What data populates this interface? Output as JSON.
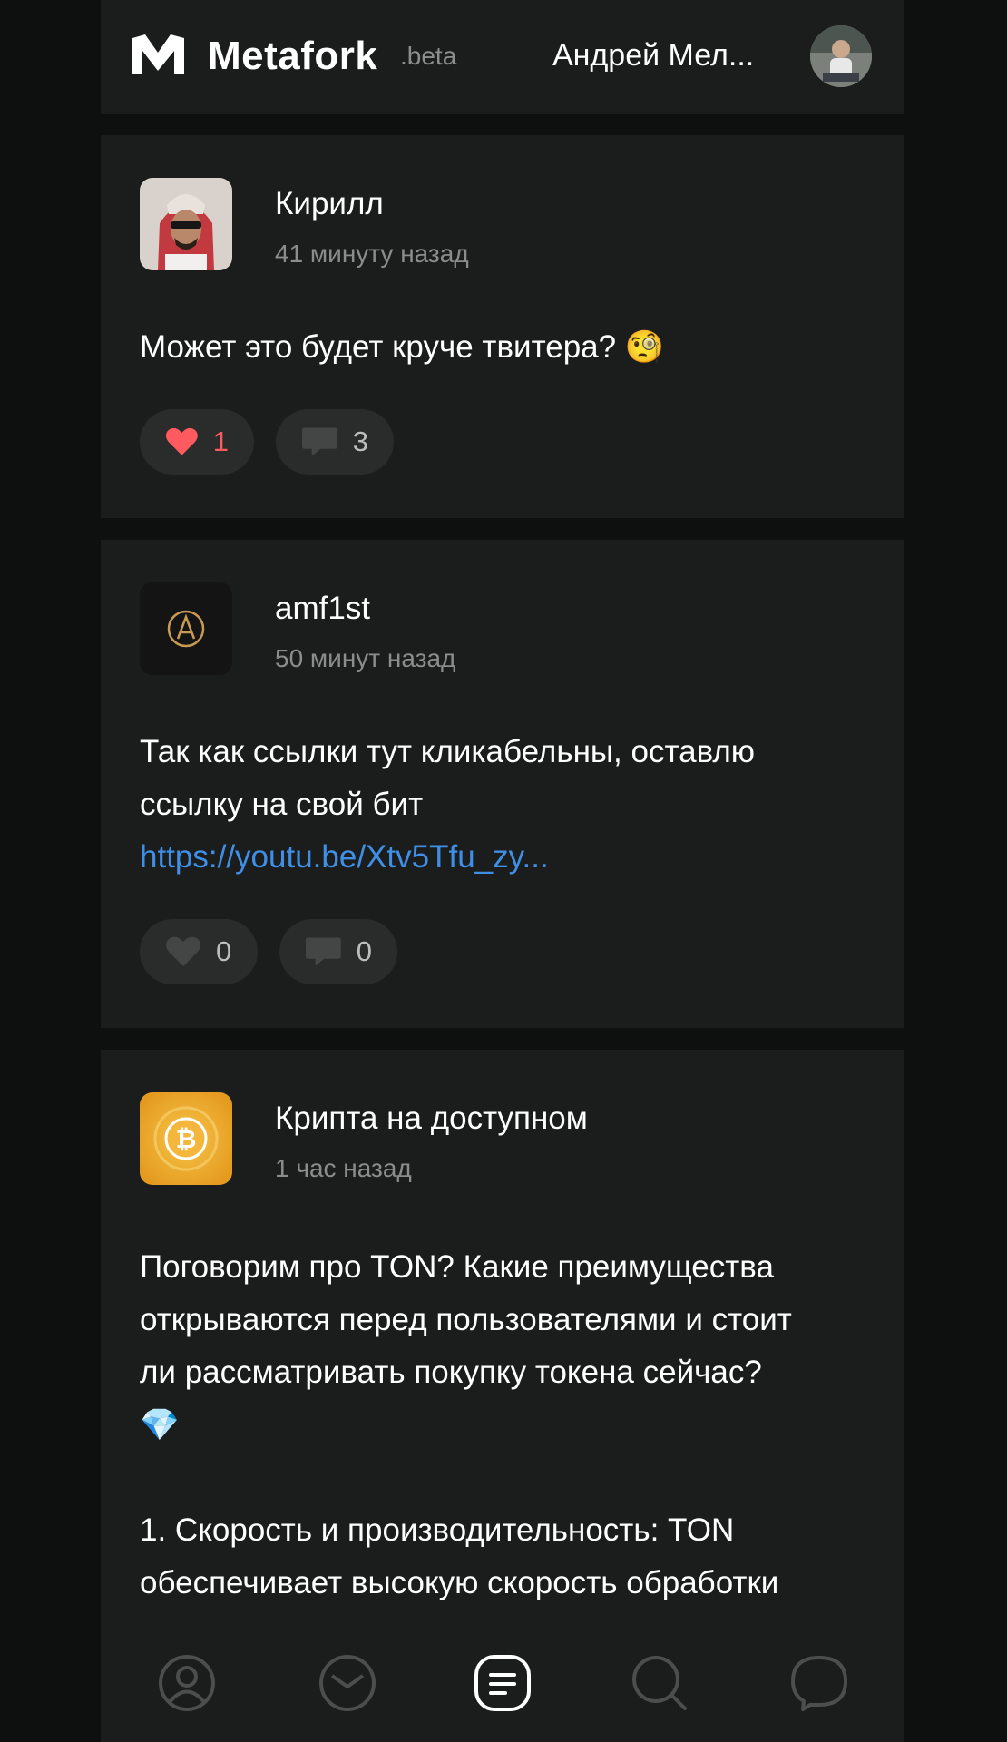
{
  "header": {
    "logo_text": "Metafork",
    "beta_label": ".beta",
    "user_name": "Андрей Мел...",
    "logo_icon": "metafork-m-logo",
    "avatar": "user-avatar-photo"
  },
  "posts": [
    {
      "author": "Кирилл",
      "time": "41 минуту назад",
      "text_lines": [
        "Может это будет круче твитера? 🧐"
      ],
      "link": "",
      "likes": "1",
      "comments": "3",
      "liked": true
    },
    {
      "author": "amf1st",
      "time": "50 минут назад",
      "text_lines": [
        "Так как ссылки тут кликабельны, оставлю",
        "ссылку на свой бит"
      ],
      "link": "https://youtu.be/Xtv5Tfu_zy...",
      "likes": "0",
      "comments": "0",
      "liked": false
    },
    {
      "author": "Крипта на доступном",
      "time": "1 час назад",
      "text_lines": [
        "Поговорим про TON? Какие преимущества",
        "открываются перед пользователями и стоит",
        "ли рассматривать покупку токена сейчас?",
        "💎",
        "",
        "1. Скорость и производительность: TON",
        "обеспечивает высокую скорость обработки"
      ],
      "link": "",
      "liked": false
    }
  ],
  "colors": {
    "background": "#0e0f0f",
    "card": "#1b1c1c",
    "pill": "#2a2b2b",
    "like_active": "#ff5a5f",
    "link": "#3f8fe6",
    "muted_text": "#8c8c8c"
  },
  "bottom_nav": [
    {
      "icon": "profile-icon"
    },
    {
      "icon": "mail-icon"
    },
    {
      "icon": "feed-icon",
      "active": true
    },
    {
      "icon": "search-icon"
    },
    {
      "icon": "chat-icon"
    }
  ]
}
